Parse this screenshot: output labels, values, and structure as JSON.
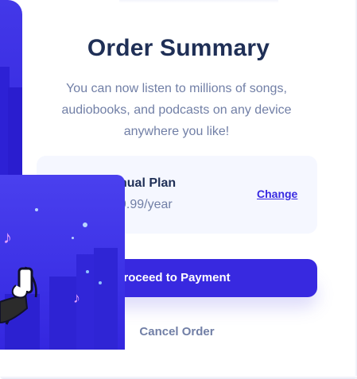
{
  "summary": {
    "title": "Order Summary",
    "description": "You can now listen to millions of songs, audiobooks, and podcasts on any device anywhere you like!",
    "plan": {
      "name": "nual Plan",
      "price": "9.99/year",
      "change_label": "Change"
    },
    "proceed_label": "roceed to Payment",
    "cancel_label": "Cancel Order"
  },
  "colors": {
    "accent": "#3829e0",
    "title": "#1f2f56",
    "muted": "#717fa6",
    "panel": "#f5f7ff"
  },
  "icons": {
    "plan_icon": "music-icon",
    "illustration_note": "music-note-icon"
  }
}
